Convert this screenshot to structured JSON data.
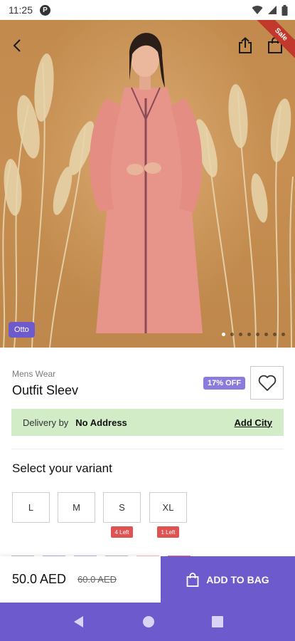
{
  "status": {
    "time": "11:25",
    "app_badge": "P"
  },
  "hero": {
    "brand": "Otto",
    "ribbon": "Sale",
    "image_dots_count": 8,
    "active_dot": 0
  },
  "product": {
    "category": "Mens Wear",
    "title": "Outfit Sleev",
    "discount": "17% OFF"
  },
  "delivery": {
    "label": "Delivery by",
    "value": "No Address",
    "link": "Add City"
  },
  "variants": {
    "title": "Select your variant",
    "sizes": [
      {
        "label": "L",
        "stock": ""
      },
      {
        "label": "M",
        "stock": ""
      },
      {
        "label": "S",
        "stock": "4 Left"
      },
      {
        "label": "XL",
        "stock": "1 Left"
      }
    ],
    "swatch_colors": [
      "#bdbdbd",
      "#b9aee6",
      "#b8b0e4",
      "#bdbdbd",
      "#f2c1b8",
      "#e57373"
    ]
  },
  "footer": {
    "price": "50.0 AED",
    "old_price": "60.0 AED",
    "add_to_bag": "ADD TO BAG"
  },
  "colors": {
    "accent": "#6d5acd",
    "delivery_bg": "#d2ecc7",
    "stock_tag": "#e05353",
    "discount": "#8b7bdc"
  }
}
